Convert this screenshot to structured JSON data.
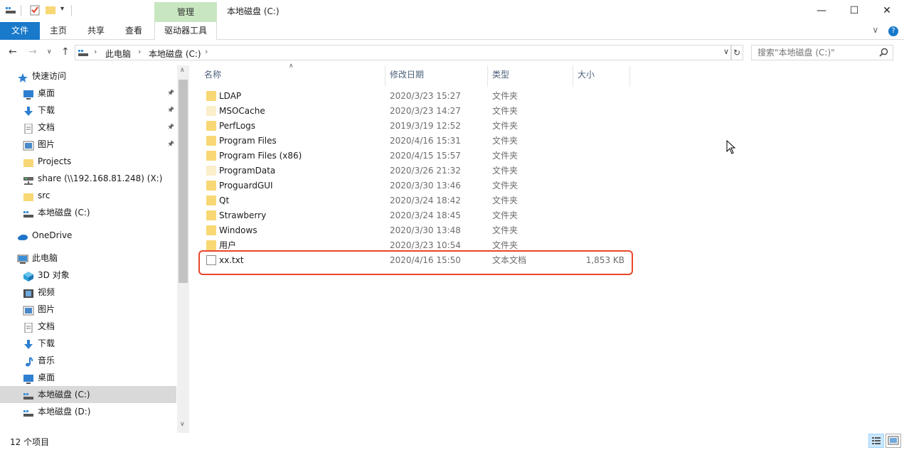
{
  "window": {
    "title": "本地磁盘 (C:)",
    "context_tab": "管理",
    "minimize": "—",
    "maximize": "☐",
    "close": "✕"
  },
  "ribbon": {
    "tabs": [
      "文件",
      "主页",
      "共享",
      "查看",
      "驱动器工具"
    ],
    "expand": "∨",
    "help": "?"
  },
  "address": {
    "crumbs": [
      "此电脑",
      "本地磁盘 (C:)"
    ],
    "search_placeholder": "搜索\"本地磁盘 (C:)\""
  },
  "nav": {
    "items": [
      {
        "label": "快速访问",
        "icon": "star-icon",
        "level": 0,
        "pinned": false
      },
      {
        "label": "桌面",
        "icon": "desktop-icon",
        "level": 1,
        "pinned": true
      },
      {
        "label": "下载",
        "icon": "download-icon",
        "level": 1,
        "pinned": true
      },
      {
        "label": "文档",
        "icon": "document-icon",
        "level": 1,
        "pinned": true
      },
      {
        "label": "图片",
        "icon": "picture-icon",
        "level": 1,
        "pinned": true
      },
      {
        "label": "Projects",
        "icon": "folder-icon",
        "level": 1,
        "pinned": false
      },
      {
        "label": "share (\\\\192.168.81.248) (X:)",
        "icon": "network-drive-icon",
        "level": 1,
        "pinned": false
      },
      {
        "label": "src",
        "icon": "folder-icon",
        "level": 1,
        "pinned": false
      },
      {
        "label": "本地磁盘 (C:)",
        "icon": "drive-icon",
        "level": 1,
        "pinned": false
      },
      {
        "label": "OneDrive",
        "icon": "cloud-icon",
        "level": 0,
        "pinned": false
      },
      {
        "label": "此电脑",
        "icon": "computer-icon",
        "level": 0,
        "pinned": false
      },
      {
        "label": "3D 对象",
        "icon": "3d-objects-icon",
        "level": 1,
        "pinned": false
      },
      {
        "label": "视频",
        "icon": "video-icon",
        "level": 1,
        "pinned": false
      },
      {
        "label": "图片",
        "icon": "picture-icon",
        "level": 1,
        "pinned": false
      },
      {
        "label": "文档",
        "icon": "document-icon",
        "level": 1,
        "pinned": false
      },
      {
        "label": "下载",
        "icon": "download-icon",
        "level": 1,
        "pinned": false
      },
      {
        "label": "音乐",
        "icon": "music-icon",
        "level": 1,
        "pinned": false
      },
      {
        "label": "桌面",
        "icon": "desktop-icon",
        "level": 1,
        "pinned": false
      },
      {
        "label": "本地磁盘 (C:)",
        "icon": "drive-icon",
        "level": 1,
        "pinned": false,
        "selected": true
      },
      {
        "label": "本地磁盘 (D:)",
        "icon": "drive-icon",
        "level": 1,
        "pinned": false
      }
    ]
  },
  "columns": {
    "name": "名称",
    "date": "修改日期",
    "type": "类型",
    "size": "大小"
  },
  "files": [
    {
      "name": "LDAP",
      "date": "2020/3/23 15:27",
      "type": "文件夹",
      "size": "",
      "kind": "folder"
    },
    {
      "name": "MSOCache",
      "date": "2020/3/23 14:27",
      "type": "文件夹",
      "size": "",
      "kind": "folder-hidden"
    },
    {
      "name": "PerfLogs",
      "date": "2019/3/19 12:52",
      "type": "文件夹",
      "size": "",
      "kind": "folder"
    },
    {
      "name": "Program Files",
      "date": "2020/4/16 15:31",
      "type": "文件夹",
      "size": "",
      "kind": "folder"
    },
    {
      "name": "Program Files (x86)",
      "date": "2020/4/15 15:57",
      "type": "文件夹",
      "size": "",
      "kind": "folder"
    },
    {
      "name": "ProgramData",
      "date": "2020/3/26 21:32",
      "type": "文件夹",
      "size": "",
      "kind": "folder-hidden"
    },
    {
      "name": "ProguardGUI",
      "date": "2020/3/30 13:46",
      "type": "文件夹",
      "size": "",
      "kind": "folder"
    },
    {
      "name": "Qt",
      "date": "2020/3/24 18:42",
      "type": "文件夹",
      "size": "",
      "kind": "folder"
    },
    {
      "name": "Strawberry",
      "date": "2020/3/24 18:45",
      "type": "文件夹",
      "size": "",
      "kind": "folder"
    },
    {
      "name": "Windows",
      "date": "2020/3/30 13:48",
      "type": "文件夹",
      "size": "",
      "kind": "folder"
    },
    {
      "name": "用户",
      "date": "2020/3/23 10:54",
      "type": "文件夹",
      "size": "",
      "kind": "folder"
    },
    {
      "name": "xx.txt",
      "date": "2020/4/16 15:50",
      "type": "文本文档",
      "size": "1,853 KB",
      "kind": "text"
    }
  ],
  "status": {
    "count": "12 个项目"
  },
  "colors": {
    "accent": "#1979ca",
    "context_tab": "#c8e7c1",
    "highlight": "#e8462c",
    "selected_nav": "#d9d9d9"
  }
}
